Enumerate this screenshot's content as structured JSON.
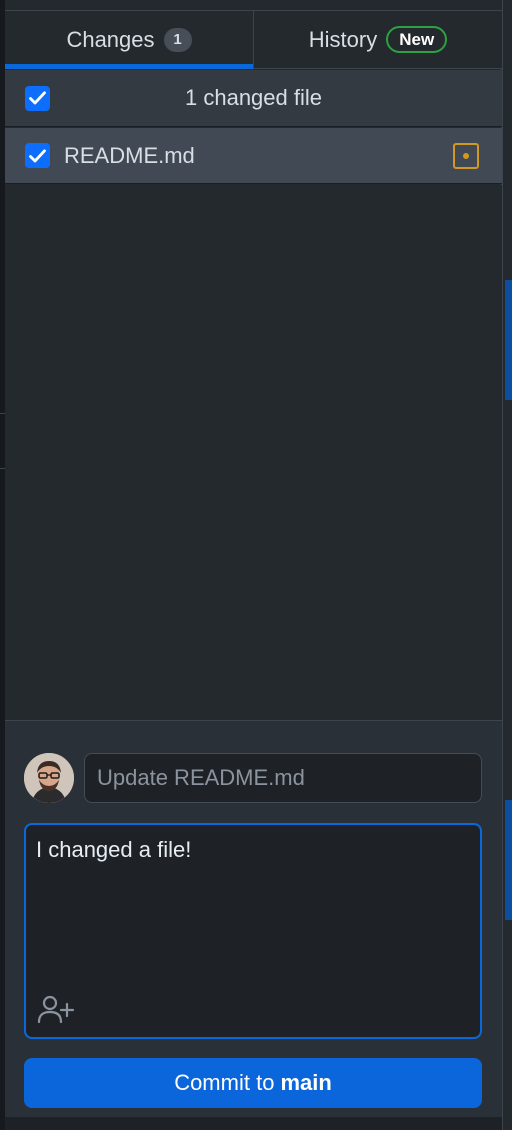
{
  "tabs": {
    "changes_label": "Changes",
    "changes_count": "1",
    "history_label": "History",
    "history_badge": "New"
  },
  "changes_header": {
    "label": "1 changed file",
    "all_checked": true
  },
  "files": [
    {
      "name": "README.md",
      "checked": true,
      "status_icon": "file-modified-icon"
    }
  ],
  "commit": {
    "summary_placeholder": "Update README.md",
    "summary_value": "",
    "description": "I changed a file!",
    "coauthor_icon": "person-add-icon",
    "button_prefix": "Commit to",
    "branch": "main"
  },
  "colors": {
    "accent": "#0969da",
    "modified": "#d29922",
    "new_badge": "#2ea043",
    "commit_button": "#0b66db"
  }
}
